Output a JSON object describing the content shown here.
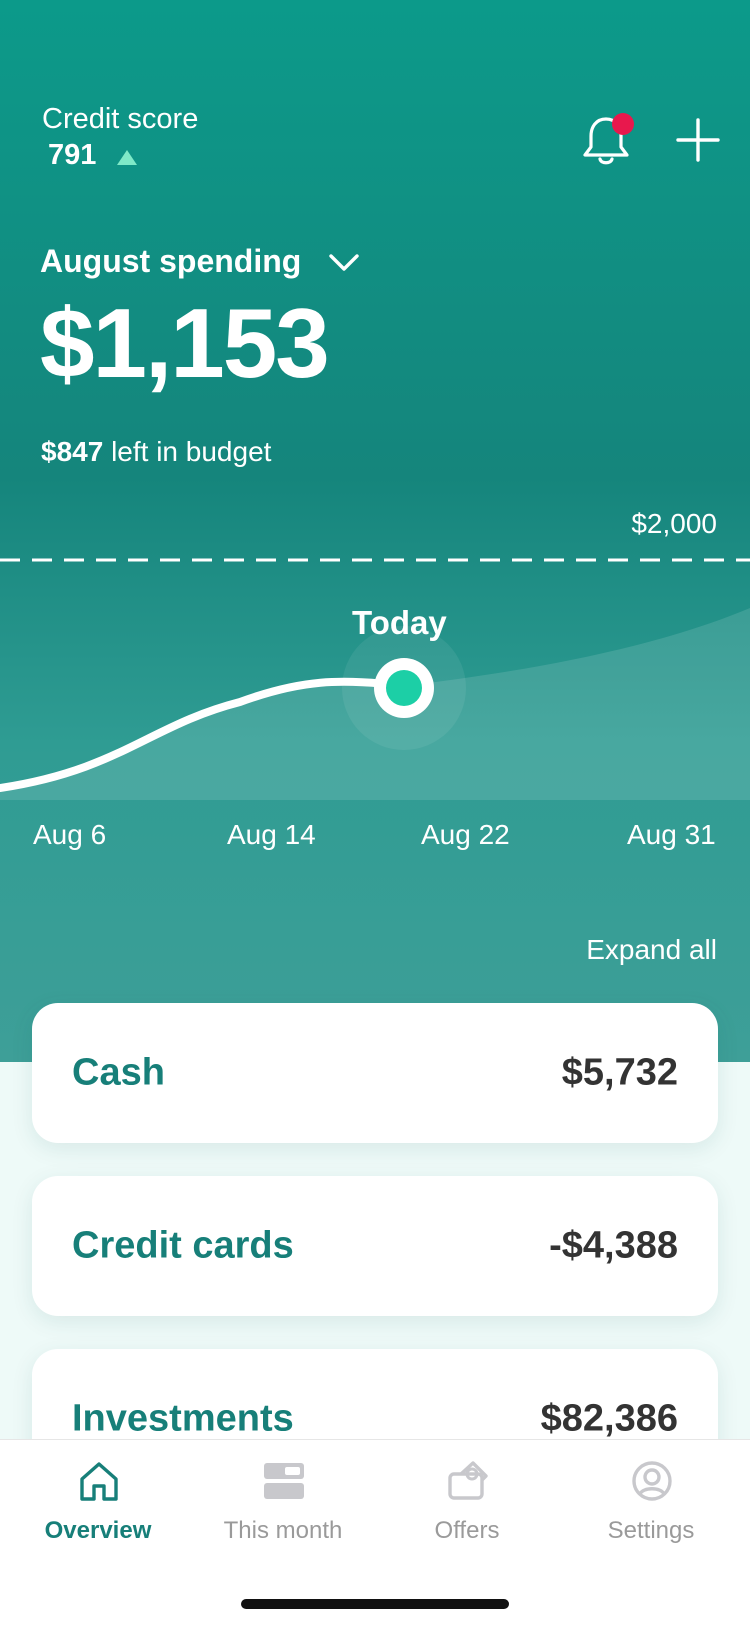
{
  "credit": {
    "label": "Credit score",
    "score": "791",
    "trend": "up"
  },
  "header": {
    "notification_badge": true
  },
  "spending": {
    "month_label": "August spending",
    "amount": "$1,153",
    "left_amount": "$847",
    "left_text": "left in budget",
    "budget_line_label": "$2,000"
  },
  "chart_data": {
    "type": "area",
    "x_labels": [
      "Aug 6",
      "Aug 14",
      "Aug 22",
      "Aug 31"
    ],
    "marker_label": "Today",
    "budget": 2000,
    "spent_to_date": 1153
  },
  "expand_all_label": "Expand all",
  "accounts": [
    {
      "name": "Cash",
      "value": "$5,732"
    },
    {
      "name": "Credit cards",
      "value": "-$4,388"
    },
    {
      "name": "Investments",
      "value": "$82,386"
    }
  ],
  "tabs": [
    {
      "label": "Overview",
      "icon": "home-icon",
      "active": true
    },
    {
      "label": "This month",
      "icon": "this-month-icon",
      "active": false
    },
    {
      "label": "Offers",
      "icon": "offers-icon",
      "active": false
    },
    {
      "label": "Settings",
      "icon": "settings-icon",
      "active": false
    }
  ],
  "colors": {
    "accent": "#177f79",
    "hero_top": "#0c9a8a",
    "notification": "#e8184d",
    "marker": "#1ccfa6"
  }
}
